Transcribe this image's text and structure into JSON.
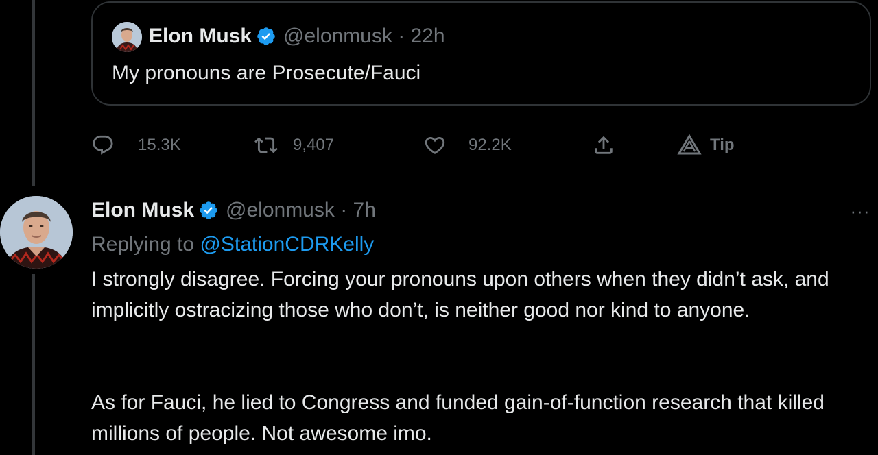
{
  "quoted_tweet": {
    "name": "Elon Musk",
    "handle_time": "@elonmusk · 22h",
    "text": "My pronouns are Prosecute/Fauci"
  },
  "actions": {
    "reply_count": "15.3K",
    "retweet_count": "9,407",
    "like_count": "92.2K",
    "tip_label": "Tip"
  },
  "tweet": {
    "name": "Elon Musk",
    "handle_time": "@elonmusk · 7h",
    "replying_prefix": "Replying to",
    "replying_to": "@StationCDRKelly",
    "paragraph1": "I strongly disagree. Forcing your pronouns upon others when they didn’t ask, and implicitly ostracizing those who don’t, is neither good nor kind to anyone.",
    "paragraph2": "As for Fauci, he lied to Congress and funded gain-of-function research that killed millions of people. Not awesome imo.",
    "more_label": "···"
  },
  "colors": {
    "background": "#000000",
    "text": "#e7e9ea",
    "secondary": "#71767b",
    "link": "#1d9bf0",
    "verified": "#1d9bf0",
    "border": "#2f3336"
  },
  "icons": {
    "reply": "speech-bubble-icon",
    "retweet": "retweet-arrows-icon",
    "like": "heart-outline-icon",
    "share": "upload-arrow-icon",
    "tip": "tip-triangle-icon",
    "verified": "verified-badge-icon"
  }
}
